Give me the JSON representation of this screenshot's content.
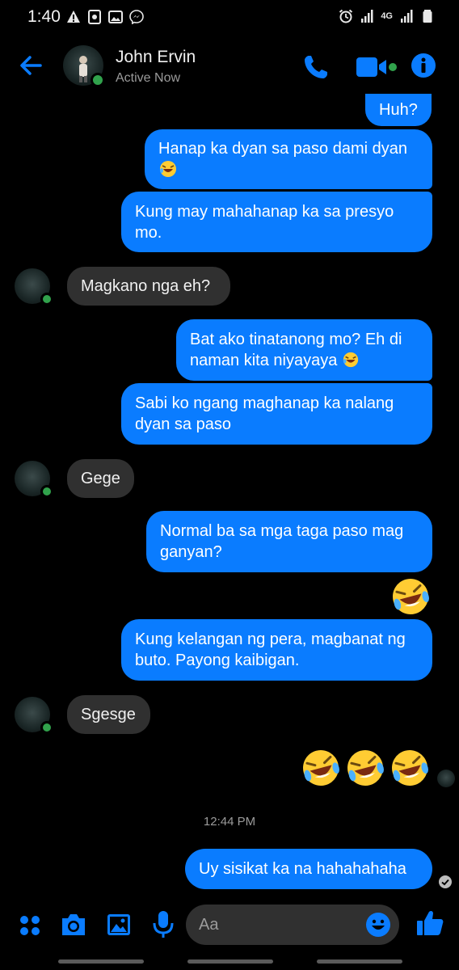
{
  "status_bar": {
    "time": "1:40",
    "network": "4G"
  },
  "header": {
    "name": "John Ervin",
    "status": "Active Now"
  },
  "messages": {
    "m1": "Huh?",
    "m2": "Hanap ka dyan sa paso dami dyan",
    "m3": "Kung may mahahanap ka sa presyo mo.",
    "m4": "Magkano nga eh?",
    "m5": "Bat ako tinatanong mo? Eh di naman kita niyayaya",
    "m6": "Sabi ko ngang maghanap ka nalang dyan sa paso",
    "m7": "Gege",
    "m8": "Normal ba sa mga taga paso mag ganyan?",
    "m9": "Kung kelangan ng pera, magbanat ng buto. Payong kaibigan.",
    "m10": "Sgesge",
    "timestamp": "12:44 PM",
    "m11": "Uy sisikat ka na hahahahaha"
  },
  "composer": {
    "placeholder": "Aa"
  },
  "colors": {
    "accent": "#0a7cff",
    "incoming": "#303030",
    "online": "#31a24c"
  }
}
